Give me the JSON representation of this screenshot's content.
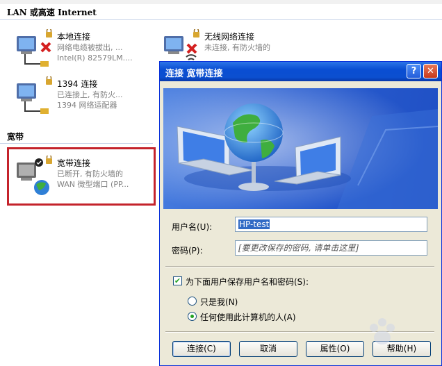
{
  "explorer": {
    "lan_section": "LAN 或高速 Internet",
    "broadband_section": "宽带",
    "connections": [
      {
        "name": "本地连接",
        "line1": "网络电缆被拔出, ...",
        "line2": "Intel(R) 82579LM...."
      },
      {
        "name": "无线网络连接",
        "line1": "未连接, 有防火墙的",
        "line2": ""
      },
      {
        "name": "1394 连接",
        "line1": "已连接上, 有防火...",
        "line2": "1394 网络适配器"
      },
      {
        "name": "宽带连接",
        "line1": "已断开, 有防火墙的",
        "line2": "WAN 微型端口 (PP..."
      }
    ]
  },
  "dialog": {
    "title": "连接 宽带连接",
    "help_button": "?",
    "close_button": "✕",
    "username_label": "用户名(U):",
    "username_value": "HP-test",
    "password_label": "密码(P):",
    "password_hint": "[要更改保存的密码, 请单击这里]",
    "save_checkbox_label": "为下面用户保存用户名和密码(S):",
    "save_checked": true,
    "radio_me_only": "只是我(N)",
    "radio_anyone": "任何使用此计算机的人(A)",
    "selected_radio": "anyone",
    "buttons": {
      "connect": "连接(C)",
      "cancel": "取消",
      "properties": "属性(O)",
      "help": "帮助(H)"
    }
  },
  "colors": {
    "titlebar": "#0b4fd0",
    "dialog_bg": "#ece9d8",
    "highlight": "#c4232b",
    "selection": "#316ac5"
  }
}
